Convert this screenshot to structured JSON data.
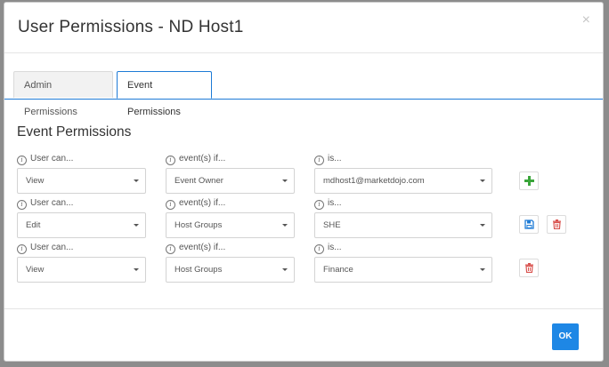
{
  "dialog": {
    "title": "User Permissions - ND Host1",
    "close_symbol": "×"
  },
  "tabs": [
    {
      "label": "Admin Permissions",
      "active": false
    },
    {
      "label": "Event Permissions",
      "active": true
    }
  ],
  "section": {
    "title": "Event Permissions",
    "label_user": "User can...",
    "label_event": "event(s) if...",
    "label_is": "is..."
  },
  "rules": [
    {
      "action": "View",
      "field": "Event Owner",
      "value": "mdhost1@marketdojo.com",
      "buttons": [
        "add"
      ]
    },
    {
      "action": "Edit",
      "field": "Host Groups",
      "value": "SHE",
      "buttons": [
        "save",
        "delete"
      ]
    },
    {
      "action": "View",
      "field": "Host Groups",
      "value": "Finance",
      "buttons": [
        "delete"
      ]
    }
  ],
  "footer": {
    "ok_label": "OK"
  },
  "colors": {
    "accent": "#1e87e5",
    "add": "#3aa53a",
    "delete": "#d9534f",
    "save": "#1e7bd6"
  },
  "icons": {
    "info": "info-icon",
    "add": "plus-icon",
    "save": "save-icon",
    "delete": "trash-icon",
    "close": "close-icon"
  }
}
